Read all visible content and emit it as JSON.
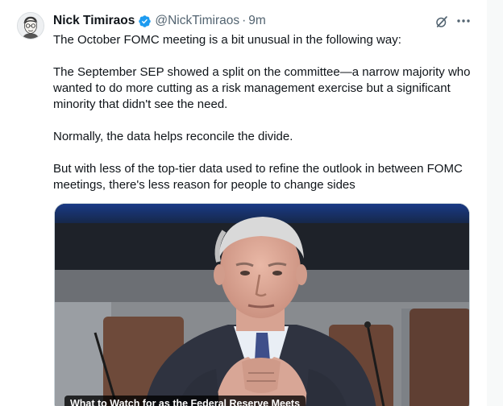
{
  "tweet": {
    "author_name": "Nick Timiraos",
    "author_handle": "@NickTimiraos",
    "separator": "·",
    "timestamp": "9m",
    "verified": true,
    "paragraphs": [
      "The October FOMC meeting is a bit unusual in the following way:",
      "The September SEP showed a split on the committee—a narrow majority who wanted to do more cutting as a risk management exercise but a significant minority that didn't see the need.",
      "Normally, the data helps reconcile the divide.",
      "But with less of the top-tier data used to refine the outlook in between FOMC meetings, there's less reason for people to change sides"
    ],
    "card_title": "What to Watch for as the Federal Reserve Meets"
  },
  "icons": {
    "verified": "verified-badge-icon",
    "grok": "grok-icon",
    "more": "more-options-icon"
  },
  "colors": {
    "verified_blue": "#1d9bf0",
    "secondary_text": "#536471",
    "primary_text": "#0f1419"
  }
}
